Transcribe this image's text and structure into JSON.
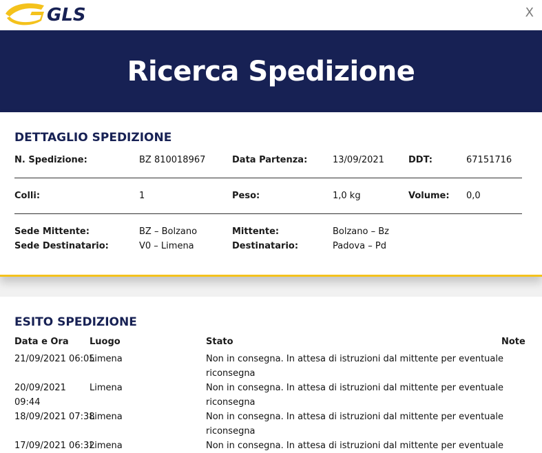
{
  "header": {
    "logo_text": "GLS",
    "close_label": "X"
  },
  "banner": {
    "title": "Ricerca Spedizione"
  },
  "detail": {
    "title": "DETTAGLIO SPEDIZIONE",
    "n_spedizione_label": "N. Spedizione:",
    "n_spedizione_value": "BZ 810018967",
    "data_partenza_label": "Data Partenza:",
    "data_partenza_value": "13/09/2021",
    "ddt_label": "DDT:",
    "ddt_value": "67151716",
    "colli_label": "Colli:",
    "colli_value": "1",
    "peso_label": "Peso:",
    "peso_value": "1,0 kg",
    "volume_label": "Volume:",
    "volume_value": "0,0",
    "sede_mittente_label": "Sede Mittente:",
    "sede_mittente_value": "BZ – Bolzano",
    "mittente_label": "Mittente:",
    "mittente_value": "Bolzano – Bz",
    "sede_destinatario_label": "Sede Destinatario:",
    "sede_destinatario_value": "V0 – Limena",
    "destinatario_label": "Destinatario:",
    "destinatario_value": "Padova – Pd"
  },
  "esito": {
    "title": "ESITO SPEDIZIONE",
    "headers": {
      "data": "Data e Ora",
      "luogo": "Luogo",
      "stato": "Stato",
      "note": "Note"
    },
    "rows": [
      {
        "data_line1": "21/09/2021 06:05",
        "data_line2": "",
        "luogo": "Limena",
        "stato_line1": "Non in consegna. In attesa di istruzioni dal mittente per eventuale",
        "stato_line2": "riconsegna"
      },
      {
        "data_line1": "20/09/2021",
        "data_line2": "09:44",
        "luogo": "Limena",
        "stato_line1": "Non in consegna. In attesa di istruzioni dal mittente per eventuale",
        "stato_line2": "riconsegna"
      },
      {
        "data_line1": "18/09/2021 07:38",
        "data_line2": "",
        "luogo": "Limena",
        "stato_line1": "Non in consegna. In attesa di istruzioni dal mittente per eventuale",
        "stato_line2": "riconsegna"
      },
      {
        "data_line1": "17/09/2021 06:32",
        "data_line2": "",
        "luogo": "Limena",
        "stato_line1": "Non in consegna. In attesa di istruzioni dal mittente per eventuale",
        "stato_line2": ""
      }
    ]
  },
  "colors": {
    "navy": "#172154",
    "yellow": "#f4c21c"
  },
  "icons": {
    "logo": "gls-logo",
    "close": "close-icon"
  }
}
